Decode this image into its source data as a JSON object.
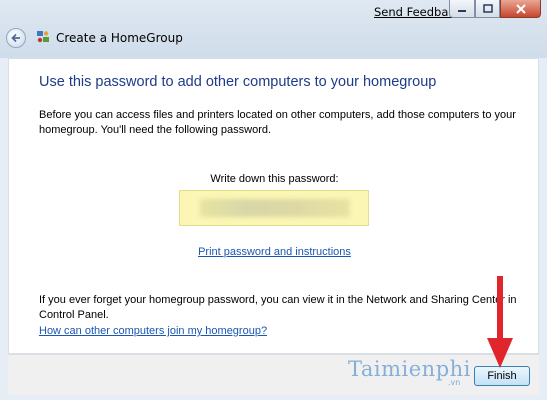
{
  "window": {
    "title": "Create a HomeGroup",
    "send_feedback": "Send Feedback"
  },
  "main": {
    "heading": "Use this password to add other computers to your homegroup",
    "intro": "Before you can access files and printers located on other computers, add those computers to your homegroup.  You'll need the following password.",
    "password_label": "Write down this password:",
    "print_link": "Print password and instructions",
    "forget_text": "If you ever forget your homegroup password, you can view it in the Network and Sharing Center in Control Panel.",
    "join_link": "How can other computers join my homegroup?"
  },
  "footer": {
    "finish_label": "Finish"
  },
  "watermark": {
    "name": "Taimienphi",
    "suffix": ".vn"
  },
  "colors": {
    "heading": "#1e3b8a",
    "link": "#1a56b3",
    "password_box": "#fbf6b4",
    "annotation_arrow": "#e0262c"
  }
}
